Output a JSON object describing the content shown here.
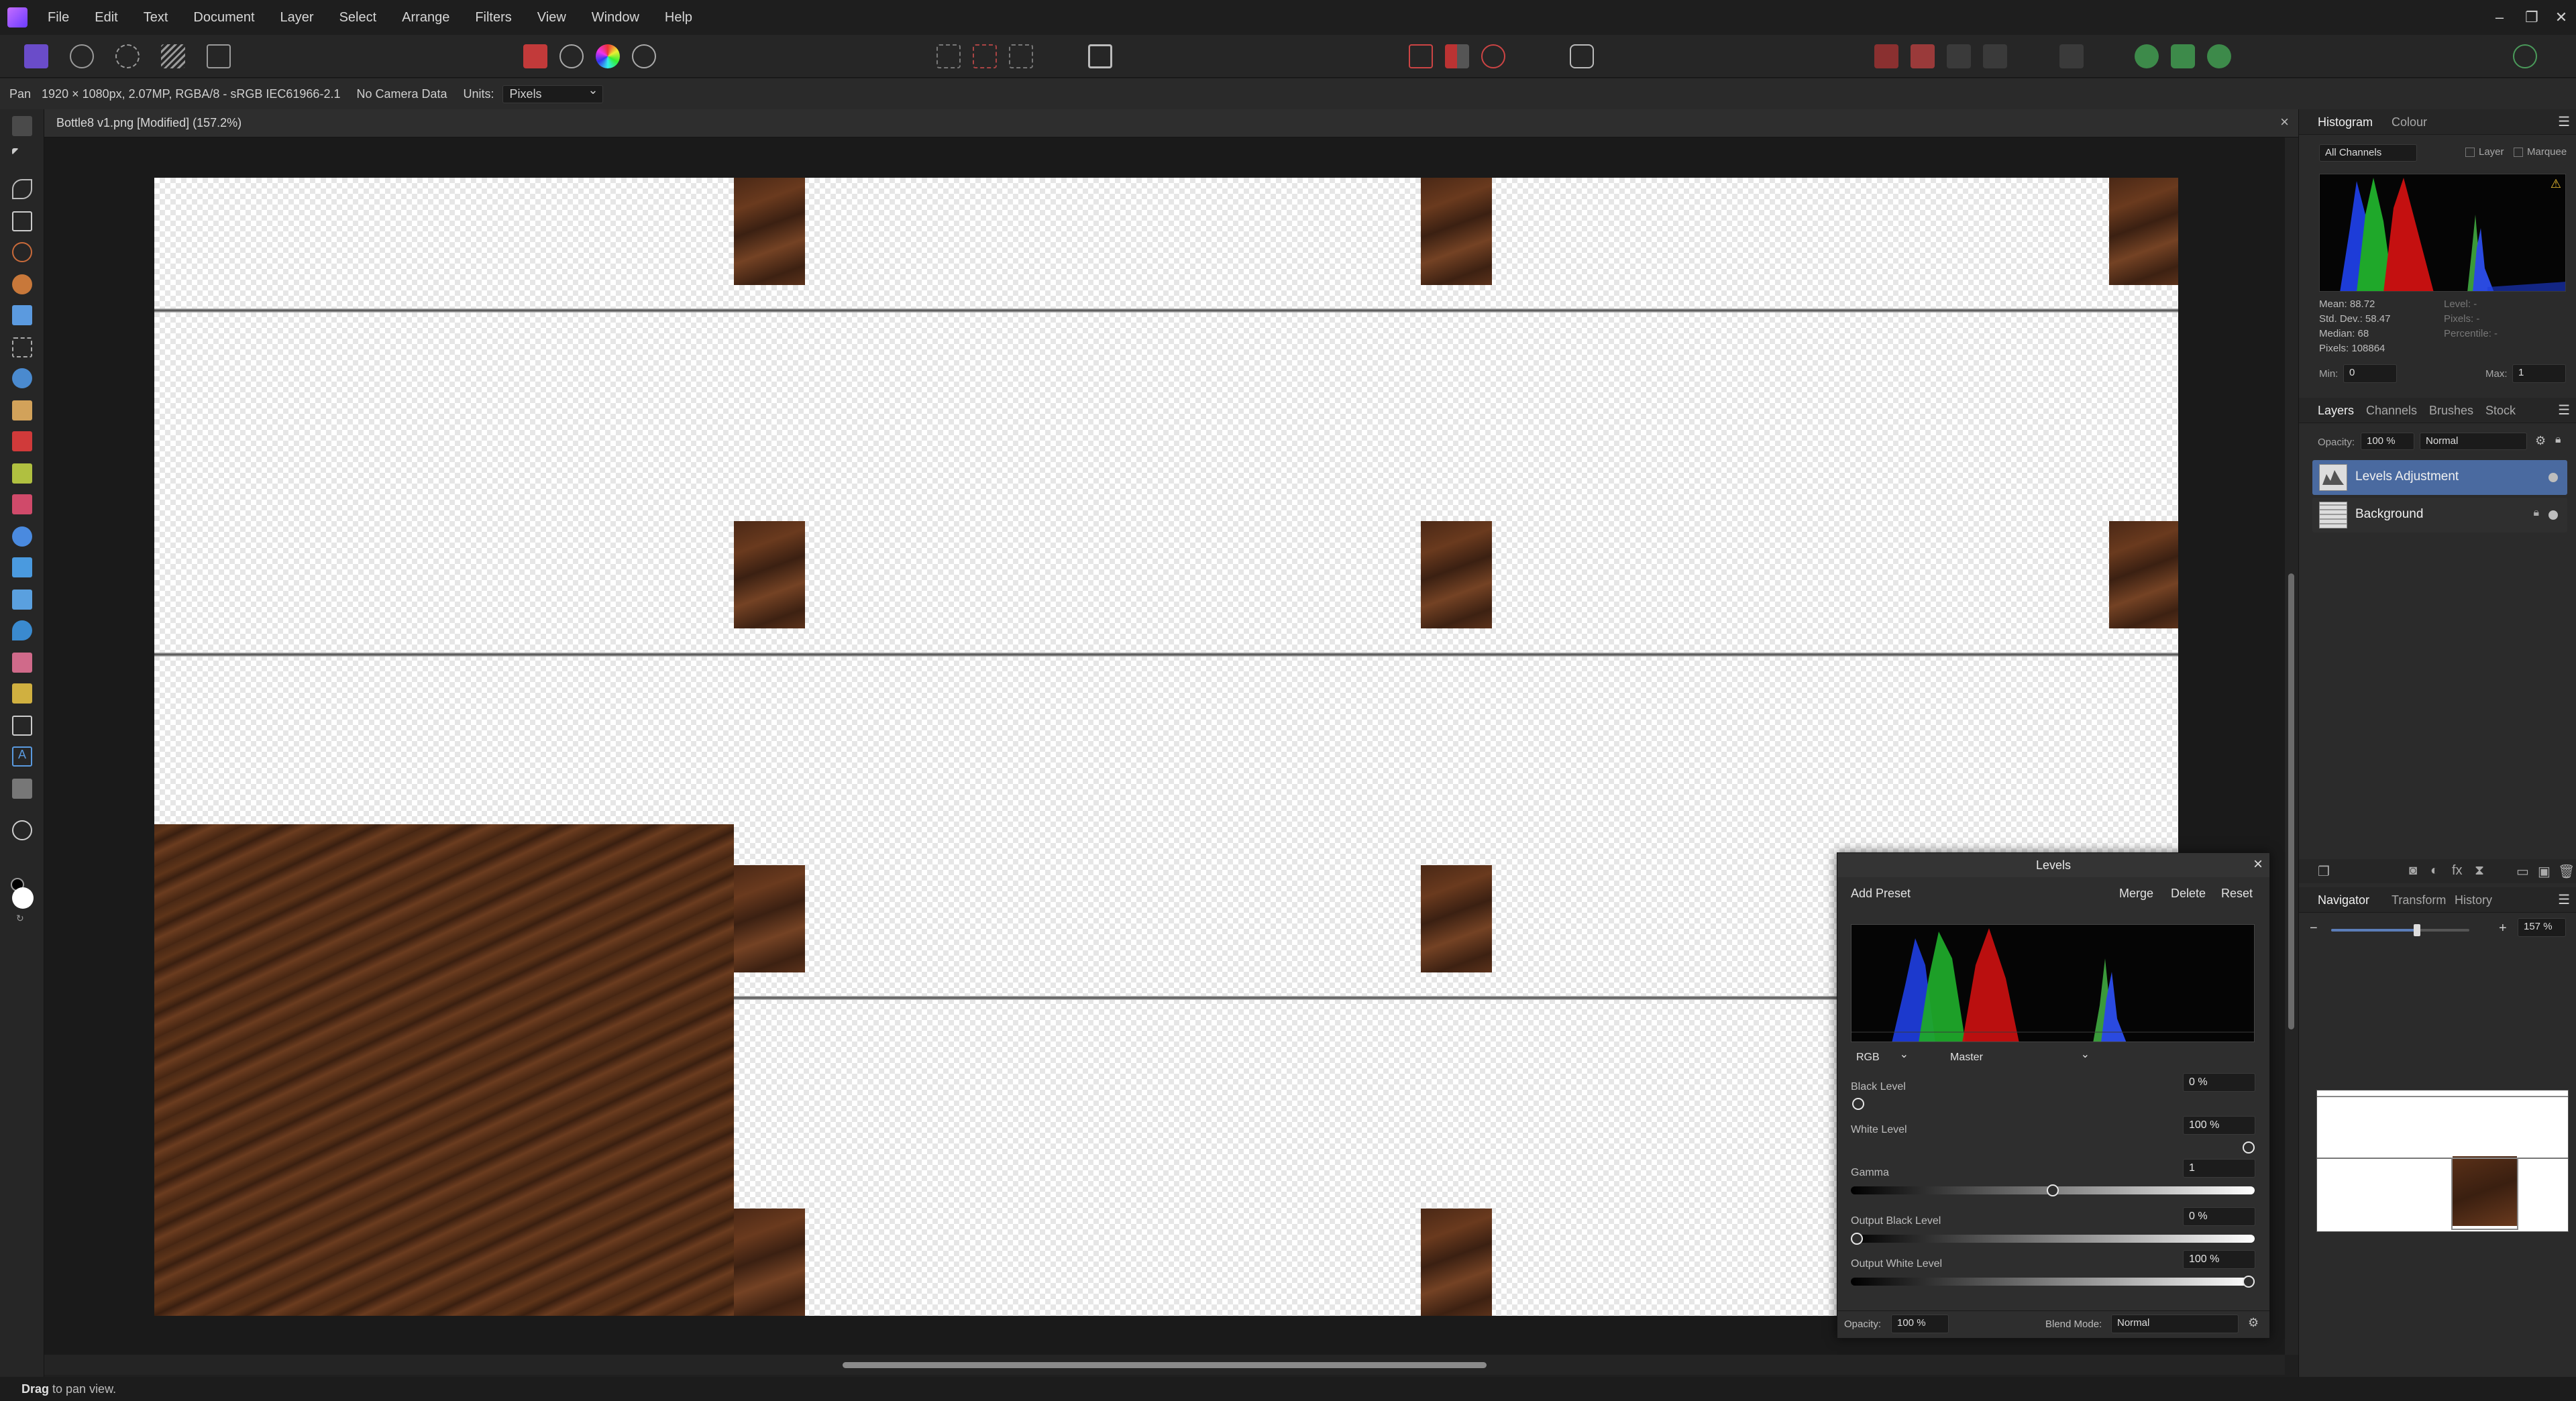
{
  "menubar": {
    "items": [
      "File",
      "Edit",
      "Text",
      "Document",
      "Layer",
      "Select",
      "Arrange",
      "Filters",
      "View",
      "Window",
      "Help"
    ]
  },
  "context": {
    "tool": "Pan",
    "info": "1920 × 1080px, 2.07MP, RGBA/8 - sRGB IEC61966-2.1",
    "camera": "No Camera Data",
    "units_label": "Units:",
    "units_value": "Pixels"
  },
  "document": {
    "title": "Bottle8 v1.png [Modified] (157.2%)"
  },
  "status": {
    "bold": "Drag",
    "text": " to pan view."
  },
  "histogram_panel": {
    "tabs": [
      "Histogram",
      "Colour"
    ],
    "channel": "All Channels",
    "layer_label": "Layer",
    "marquee_label": "Marquee",
    "stats": [
      "Mean: 88.72",
      "Std. Dev.: 58.47",
      "Median: 68",
      "Pixels: 108864"
    ],
    "stats_right": [
      "Level: -",
      "Pixels: -",
      "Percentile: -"
    ],
    "min_label": "Min:",
    "min_value": "0",
    "max_label": "Max:",
    "max_value": "1",
    "warning_icon": "warning-icon"
  },
  "layers_panel": {
    "tabs": [
      "Layers",
      "Channels",
      "Brushes",
      "Stock"
    ],
    "opacity_label": "Opacity:",
    "opacity_value": "100 %",
    "blend_mode": "Normal",
    "layers": [
      {
        "name": "Levels Adjustment",
        "selected": true
      },
      {
        "name": "Background",
        "selected": false,
        "locked": true
      }
    ]
  },
  "navigator_panel": {
    "tabs": [
      "Navigator",
      "Transform",
      "History"
    ],
    "zoom_value": "157 %",
    "zoom_level": 0.62
  },
  "levels": {
    "title": "Levels",
    "add_preset": "Add Preset",
    "merge": "Merge",
    "delete": "Delete",
    "reset": "Reset",
    "color_space": "RGB",
    "channel": "Master",
    "black_level_label": "Black Level",
    "black_level_value": "0 %",
    "white_level_label": "White Level",
    "white_level_value": "100 %",
    "gamma_label": "Gamma",
    "gamma_value": "1",
    "output_black_label": "Output Black Level",
    "output_black_value": "0 %",
    "output_white_label": "Output White Level",
    "output_white_value": "100 %",
    "opacity_label": "Opacity:",
    "opacity_value": "100 %",
    "blend_label": "Blend Mode:",
    "blend_value": "Normal"
  },
  "colors": {
    "accent": "#5b7db8",
    "selected_layer": "#4a6aa0"
  }
}
